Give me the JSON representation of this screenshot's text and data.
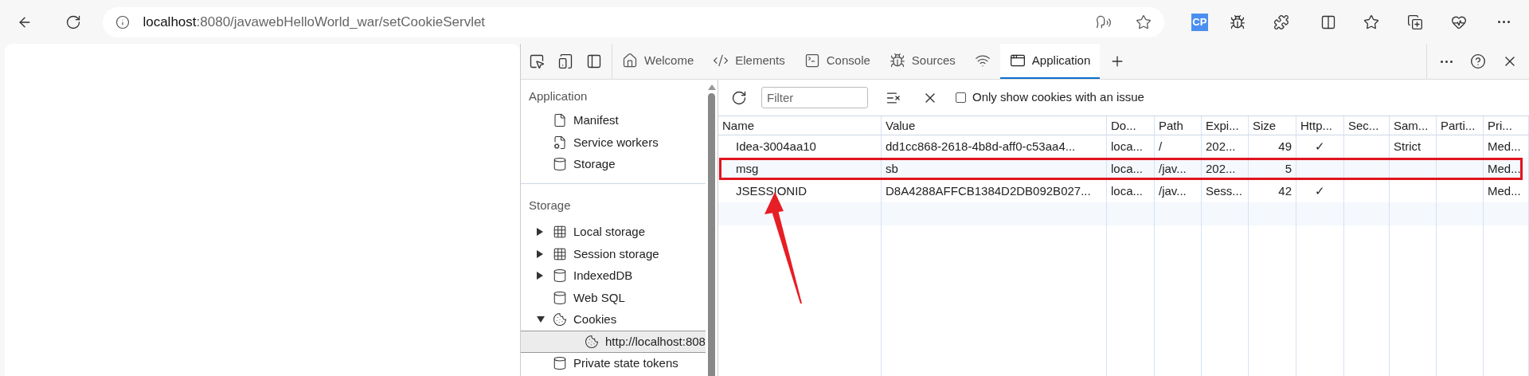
{
  "browser": {
    "address": {
      "host": "localhost",
      "rest": ":8080/javawebHelloWorld_war/setCookieServlet"
    },
    "extension_badge": "CP"
  },
  "devtools": {
    "tabs": [
      {
        "label": "Welcome",
        "selected": false
      },
      {
        "label": "Elements",
        "selected": false
      },
      {
        "label": "Console",
        "selected": false
      },
      {
        "label": "Sources",
        "selected": false
      },
      {
        "selected": false
      },
      {
        "label": "Application",
        "selected": true
      }
    ],
    "sidebar": [
      {
        "title": "Application",
        "items": [
          {
            "label": "Manifest",
            "selected": false
          },
          {
            "label": "Service workers",
            "selected": false
          },
          {
            "label": "Storage",
            "selected": false
          }
        ]
      },
      {
        "title": "Storage",
        "items": [
          {
            "label": "Local storage",
            "expanded": false,
            "selected": false
          },
          {
            "label": "Session storage",
            "expanded": false,
            "selected": false
          },
          {
            "label": "IndexedDB",
            "expanded": false,
            "selected": false
          },
          {
            "label": "Web SQL",
            "selected": false
          },
          {
            "label": "Cookies",
            "expanded": true,
            "selected": false,
            "children": [
              {
                "label": "http://localhost:808",
                "selected": true
              }
            ]
          },
          {
            "label": "Private state tokens",
            "selected": false
          }
        ]
      }
    ],
    "toolbar": {
      "filter": {
        "placeholder": "Filter"
      },
      "checkbox": {
        "label": "Only show cookies with an issue",
        "checked": false
      }
    },
    "table": {
      "columns": [
        "Name",
        "Value",
        "Do...",
        "Path",
        "Expi...",
        "Size",
        "Http...",
        "Sec...",
        "Sam...",
        "Parti...",
        "Pri..."
      ],
      "rows": [
        {
          "cells": [
            "Idea-3004aa10",
            "dd1cc868-2618-4b8d-aff0-c53aa4...",
            "loca...",
            "/",
            "202...",
            "49",
            "✓",
            "",
            "Strict",
            "",
            "Med..."
          ],
          "highlighted": false
        },
        {
          "cells": [
            "msg",
            "sb",
            "loca...",
            "/jav...",
            "202...",
            "5",
            "",
            "",
            "",
            "",
            "Med..."
          ],
          "highlighted": true
        },
        {
          "cells": [
            "JSESSIONID",
            "D8A4288AFFCB1384D2DB092B027...",
            "loca...",
            "/jav...",
            "Sess...",
            "42",
            "✓",
            "",
            "",
            "",
            "Med..."
          ],
          "highlighted": false
        }
      ]
    },
    "pointer_arrow": true
  }
}
